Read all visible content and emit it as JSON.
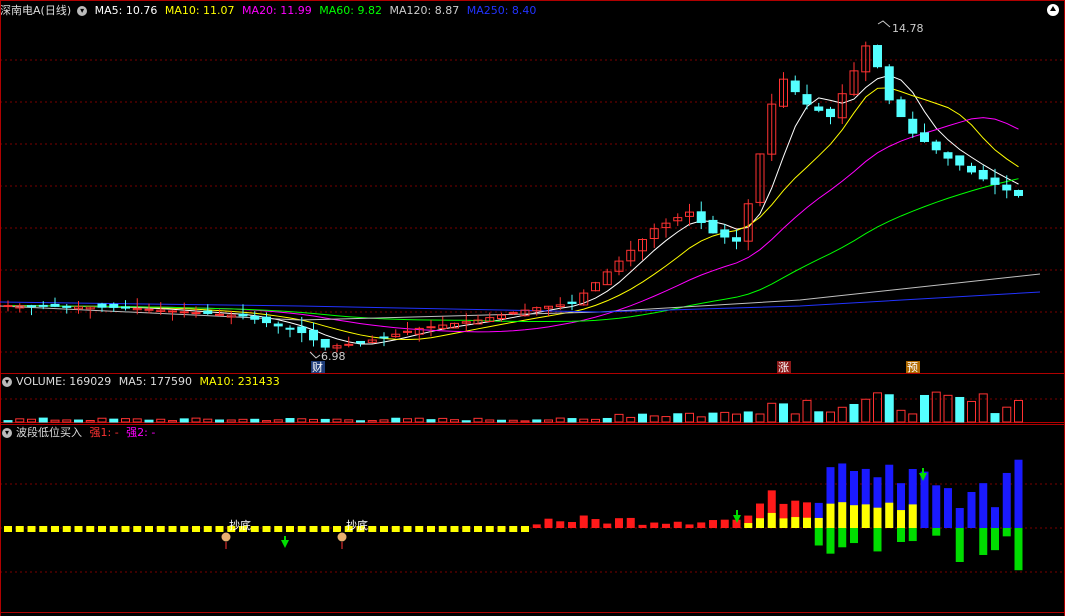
{
  "main_legend": {
    "title": "深南电A(日线)",
    "indicators": [
      {
        "label": "MA5: 10.76",
        "color": "#ffffff"
      },
      {
        "label": "MA10: 11.07",
        "color": "#ffff00"
      },
      {
        "label": "MA20: 11.99",
        "color": "#ff00ff"
      },
      {
        "label": "MA60: 9.82",
        "color": "#00ff00"
      },
      {
        "label": "MA120: 8.87",
        "color": "#c0c0c0"
      },
      {
        "label": "MA250: 8.40",
        "color": "#0000ff"
      }
    ]
  },
  "price_high_label": "14.78",
  "price_low_label": "6.98",
  "markers": {
    "cai": "财",
    "zhang": "涨",
    "yu": "预"
  },
  "volume_legend": {
    "label": "VOLUME: 169029",
    "ma5": "MA5: 177590",
    "ma10": "MA10: 231433"
  },
  "indicator_legend": {
    "name": "波段低位买入",
    "s1": "强1: -",
    "s2": "强2: -"
  },
  "bottom_labels": [
    "抄底",
    "抄底"
  ],
  "colors": {
    "up": "#ff3232",
    "down": "#54ffff",
    "grid": "#8b0000",
    "axis": "#b00000"
  }
}
